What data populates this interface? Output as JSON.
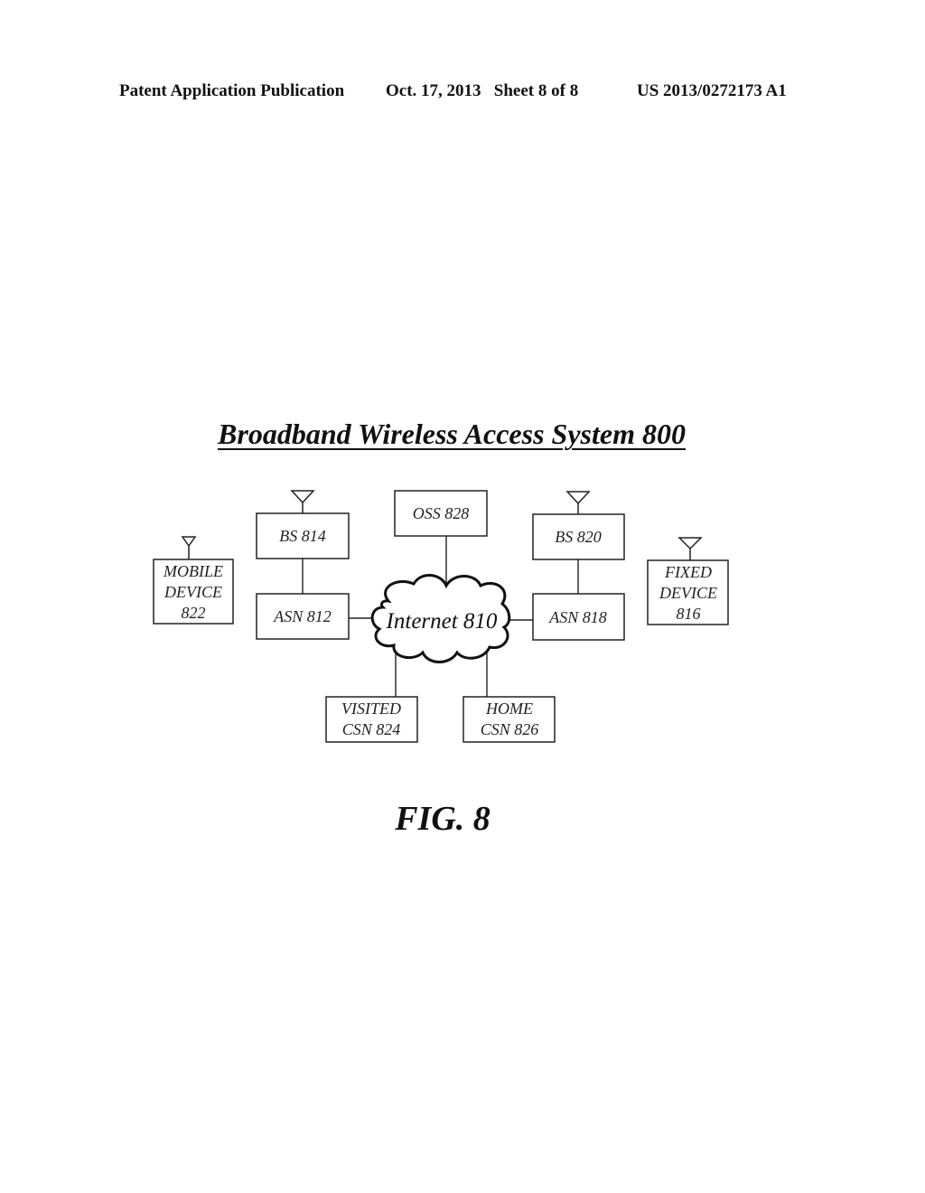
{
  "header": {
    "left": "Patent Application Publication",
    "middle": "Oct. 17, 2013   Sheet 8 of 8",
    "right": "US 2013/0272173 A1"
  },
  "diagram": {
    "title": "Broadband Wireless Access System 800",
    "nodes": {
      "mobile_device": {
        "lines": [
          "MOBILE",
          "DEVICE",
          "822"
        ],
        "has_antenna": true
      },
      "bs_814": {
        "lines": [
          "BS 814"
        ],
        "has_antenna": true
      },
      "asn_812": {
        "lines": [
          "ASN 812"
        ]
      },
      "oss_828": {
        "lines": [
          "OSS 828"
        ]
      },
      "internet": {
        "lines": [
          "Internet 810"
        ],
        "shape": "cloud"
      },
      "bs_820": {
        "lines": [
          "BS 820"
        ],
        "has_antenna": true
      },
      "asn_818": {
        "lines": [
          "ASN 818"
        ]
      },
      "fixed_device": {
        "lines": [
          "FIXED",
          "DEVICE",
          "816"
        ],
        "has_antenna": true
      },
      "visited_csn": {
        "lines": [
          "VISITED",
          "CSN 824"
        ]
      },
      "home_csn": {
        "lines": [
          "HOME",
          "CSN 826"
        ]
      }
    },
    "connections": [
      [
        "bs_814",
        "asn_812"
      ],
      [
        "asn_812",
        "internet"
      ],
      [
        "oss_828",
        "internet"
      ],
      [
        "bs_820",
        "asn_818"
      ],
      [
        "internet",
        "asn_818"
      ],
      [
        "internet",
        "visited_csn"
      ],
      [
        "internet",
        "home_csn"
      ]
    ]
  },
  "figure_label": "FIG. 8"
}
